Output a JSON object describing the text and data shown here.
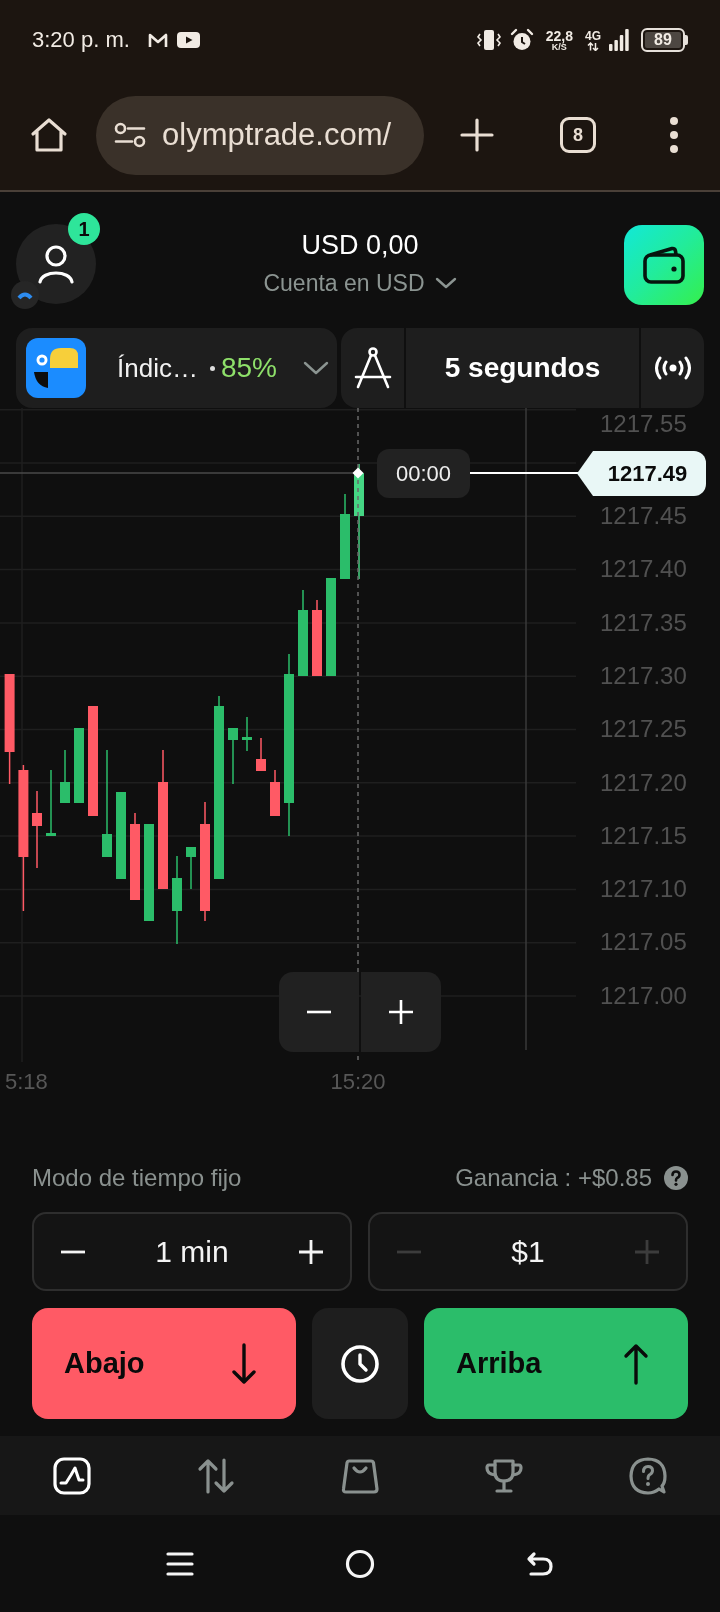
{
  "status_bar": {
    "time": "3:20 p. m.",
    "data_rate": "22,8",
    "data_rate_unit": "K/S",
    "network": "4G",
    "battery": "89"
  },
  "browser": {
    "url": "olymptrade.com/",
    "tab_count": "8"
  },
  "header": {
    "notifications": "1",
    "balance": "USD 0,00",
    "account": "Cuenta en USD"
  },
  "asset": {
    "name": "Índic…",
    "payout": "85%"
  },
  "toolbar": {
    "timeframe": "5 segundos"
  },
  "chart": {
    "y_axis_labels": [
      "1217.55",
      "1217.45",
      "1217.40",
      "1217.35",
      "1217.30",
      "1217.25",
      "1217.20",
      "1217.15",
      "1217.10",
      "1217.05",
      "1217.00"
    ],
    "x_axis_labels": [
      "5:18",
      "15:20"
    ],
    "time_label": "00:00",
    "price_label": "1217.49"
  },
  "trade": {
    "mode": "Modo de tiempo fijo",
    "profit": "Ganancia : +$0.85",
    "steppers": [
      {
        "value": "1 min",
        "decrease_disabled": false,
        "increase_disabled": false
      },
      {
        "value": "$1",
        "decrease_disabled": true,
        "increase_disabled": true
      }
    ],
    "actions": [
      {
        "kind": "down",
        "label": "Abajo"
      },
      {
        "kind": "timer"
      },
      {
        "kind": "up",
        "label": "Arriba"
      }
    ]
  },
  "bottom_nav": [
    {
      "kind": "chart",
      "selected": true
    },
    {
      "kind": "trades",
      "selected": false
    },
    {
      "kind": "market",
      "selected": false
    },
    {
      "kind": "rewards",
      "selected": false
    },
    {
      "kind": "support",
      "selected": false
    }
  ]
}
